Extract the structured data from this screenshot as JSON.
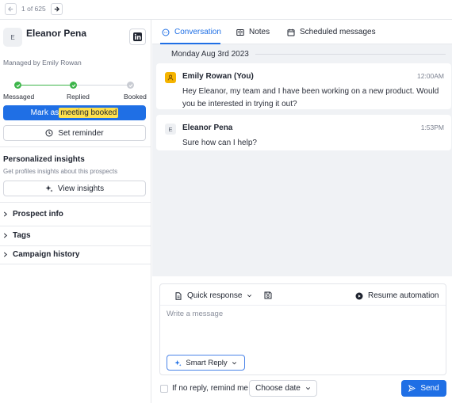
{
  "pager": {
    "text": "1 of 625"
  },
  "prospect": {
    "initial": "E",
    "name": "Eleanor Pena",
    "managed_by": "Managed by Emily Rowan"
  },
  "pipeline": {
    "steps": [
      {
        "label": "Messaged",
        "done": true
      },
      {
        "label": "Replied",
        "done": true
      },
      {
        "label": "Booked",
        "done": false
      }
    ],
    "done_color": "#3db54a",
    "pending_color": "#c9ccd3"
  },
  "actions": {
    "mark_prefix": "Mark as",
    "mark_highlight": "meeting booked",
    "set_reminder": "Set reminder"
  },
  "insights": {
    "title": "Personalized insights",
    "subtitle": "Get profiles insights about this prospects",
    "button": "View insights"
  },
  "sections": [
    {
      "label": "Prospect info"
    },
    {
      "label": "Tags"
    },
    {
      "label": "Campaign history"
    }
  ],
  "tabs": [
    {
      "label": "Conversation",
      "icon": "chat-icon",
      "active": true
    },
    {
      "label": "Notes",
      "icon": "notebook-icon",
      "active": false
    },
    {
      "label": "Scheduled messages",
      "icon": "calendar-icon",
      "active": false
    }
  ],
  "conversation": {
    "date": "Monday Aug 3rd 2023",
    "messages": [
      {
        "initial": "",
        "sender": "Emily Rowan (You)",
        "time": "12:00AM",
        "body": "Hey Eleanor, my team and I have been working on a new product. Would you be interested in trying it out?"
      },
      {
        "initial": "E",
        "sender": "Eleanor Pena",
        "time": "1:53PM",
        "body": "Sure how can I help?"
      }
    ]
  },
  "composer": {
    "quick_response": "Quick response",
    "resume": "Resume automation",
    "placeholder": "Write a message",
    "smart_reply": "Smart Reply",
    "no_reply": "If no reply, remind me",
    "choose_date": "Choose date",
    "send": "Send"
  },
  "colors": {
    "accent": "#1f6fe5",
    "highlight": "#ffe14d",
    "user_avatar": "#f5b400"
  }
}
